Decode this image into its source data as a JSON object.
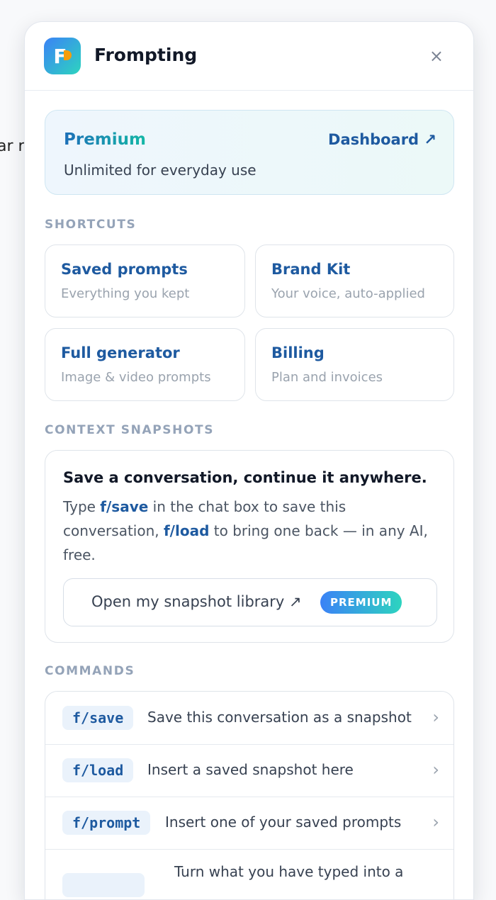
{
  "background": {
    "text": "ar r"
  },
  "header": {
    "app_name": "Frompting",
    "logo_letter": "F",
    "close_label": "×"
  },
  "premium": {
    "title": "Premium",
    "link": "Dashboard ↗",
    "subtitle": "Unlimited for everyday use"
  },
  "shortcuts": {
    "label": "SHORTCUTS",
    "items": [
      {
        "title": "Saved prompts",
        "subtitle": "Everything you kept"
      },
      {
        "title": "Brand Kit",
        "subtitle": "Your voice, auto-applied"
      },
      {
        "title": "Full generator",
        "subtitle": "Image & video prompts"
      },
      {
        "title": "Billing",
        "subtitle": "Plan and invoices"
      }
    ]
  },
  "snapshots": {
    "label": "CONTEXT SNAPSHOTS",
    "heading": "Save a conversation, continue it anywhere.",
    "body_1": "Type ",
    "cmd_save": "f/save",
    "body_2": " in the chat box to save this conversation, ",
    "cmd_load": "f/load",
    "body_3": " to bring one back — in any AI, free.",
    "button_label": "Open my snapshot library ↗",
    "badge": "PREMIUM"
  },
  "commands": {
    "label": "COMMANDS",
    "items": [
      {
        "command": "f/save",
        "description": "Save this conversation as a snapshot"
      },
      {
        "command": "f/load",
        "description": "Insert a saved snapshot here"
      },
      {
        "command": "f/prompt",
        "description": "Insert one of your saved prompts"
      },
      {
        "command": "",
        "description": "Turn what you have typed into a"
      }
    ],
    "chevron": "›"
  },
  "colors": {
    "accent": "#1e5aa0",
    "teal": "#2dd4bf",
    "muted": "#94a3b8"
  }
}
